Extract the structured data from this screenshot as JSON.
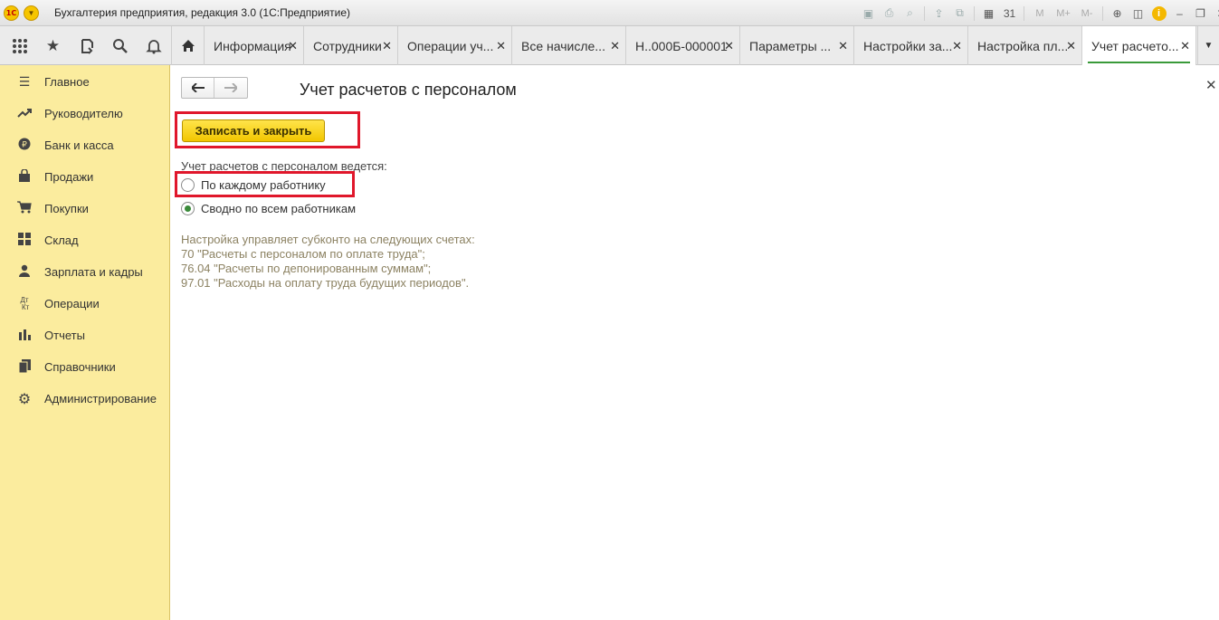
{
  "window": {
    "logo": "1С",
    "title": "Бухгалтерия предприятия, редакция 3.0  (1С:Предприятие)",
    "memory_buttons": [
      "M",
      "M+",
      "M-"
    ],
    "calendar_day": "31"
  },
  "toolbar": {
    "tools": [
      {
        "name": "apps-grid-icon",
        "glyph": "⋮⋮⋮"
      },
      {
        "name": "star-icon",
        "glyph": "★"
      },
      {
        "name": "history-icon",
        "glyph": "⟲"
      },
      {
        "name": "search-icon",
        "glyph": "⌕"
      },
      {
        "name": "bell-icon",
        "glyph": "🔔"
      }
    ],
    "tabs": [
      {
        "label": "Информация",
        "width": 110
      },
      {
        "label": "Сотрудники",
        "width": 104
      },
      {
        "label": "Операции уч...",
        "width": 126
      },
      {
        "label": "Все начисле...",
        "width": 126
      },
      {
        "label": "Н..000Б-000001",
        "width": 126
      },
      {
        "label": "Параметры ...",
        "width": 126
      },
      {
        "label": "Настройки за...",
        "width": 126
      },
      {
        "label": "Настройка пл...",
        "width": 126
      },
      {
        "label": "Учет расчето...",
        "width": 126,
        "active": true
      }
    ]
  },
  "sidebar": {
    "items": [
      {
        "label": "Главное",
        "icon": "menu-lines-icon",
        "glyph": "≡"
      },
      {
        "label": "Руководителю",
        "icon": "trend-up-icon",
        "glyph": "↗"
      },
      {
        "label": "Банк и касса",
        "icon": "coin-icon",
        "glyph": "₽"
      },
      {
        "label": "Продажи",
        "icon": "bag-icon",
        "glyph": "▰"
      },
      {
        "label": "Покупки",
        "icon": "cart-icon",
        "glyph": "🛒"
      },
      {
        "label": "Склад",
        "icon": "warehouse-icon",
        "glyph": "▦"
      },
      {
        "label": "Зарплата и кадры",
        "icon": "person-icon",
        "glyph": "👤"
      },
      {
        "label": "Операции",
        "icon": "debit-credit-icon",
        "glyph": "ᴰᴷ"
      },
      {
        "label": "Отчеты",
        "icon": "bar-chart-icon",
        "glyph": "▮"
      },
      {
        "label": "Справочники",
        "icon": "book-icon",
        "glyph": "▤"
      },
      {
        "label": "Администрирование",
        "icon": "gear-icon",
        "glyph": "⚙"
      }
    ]
  },
  "form": {
    "title": "Учет расчетов с персоналом",
    "save_label": "Записать и закрыть",
    "radio_caption": "Учет расчетов с персоналом ведется:",
    "options": [
      {
        "label": "По каждому работнику",
        "checked": false
      },
      {
        "label": "Сводно по всем работникам",
        "checked": true
      }
    ],
    "note_lines": [
      "Настройка управляет субконто на следующих счетах:",
      "70 \"Расчеты с персоналом по оплате труда\";",
      "76.04 \"Расчеты по депонированным суммам\";",
      "97.01 \"Расходы на оплату труда будущих периодов\"."
    ]
  },
  "colors": {
    "sidebar_bg": "#fbec9e",
    "save_button": "#f6d000",
    "highlight": "#e0172b",
    "active_tab_underline": "#3a9a3a",
    "note_text": "#8c8262"
  }
}
